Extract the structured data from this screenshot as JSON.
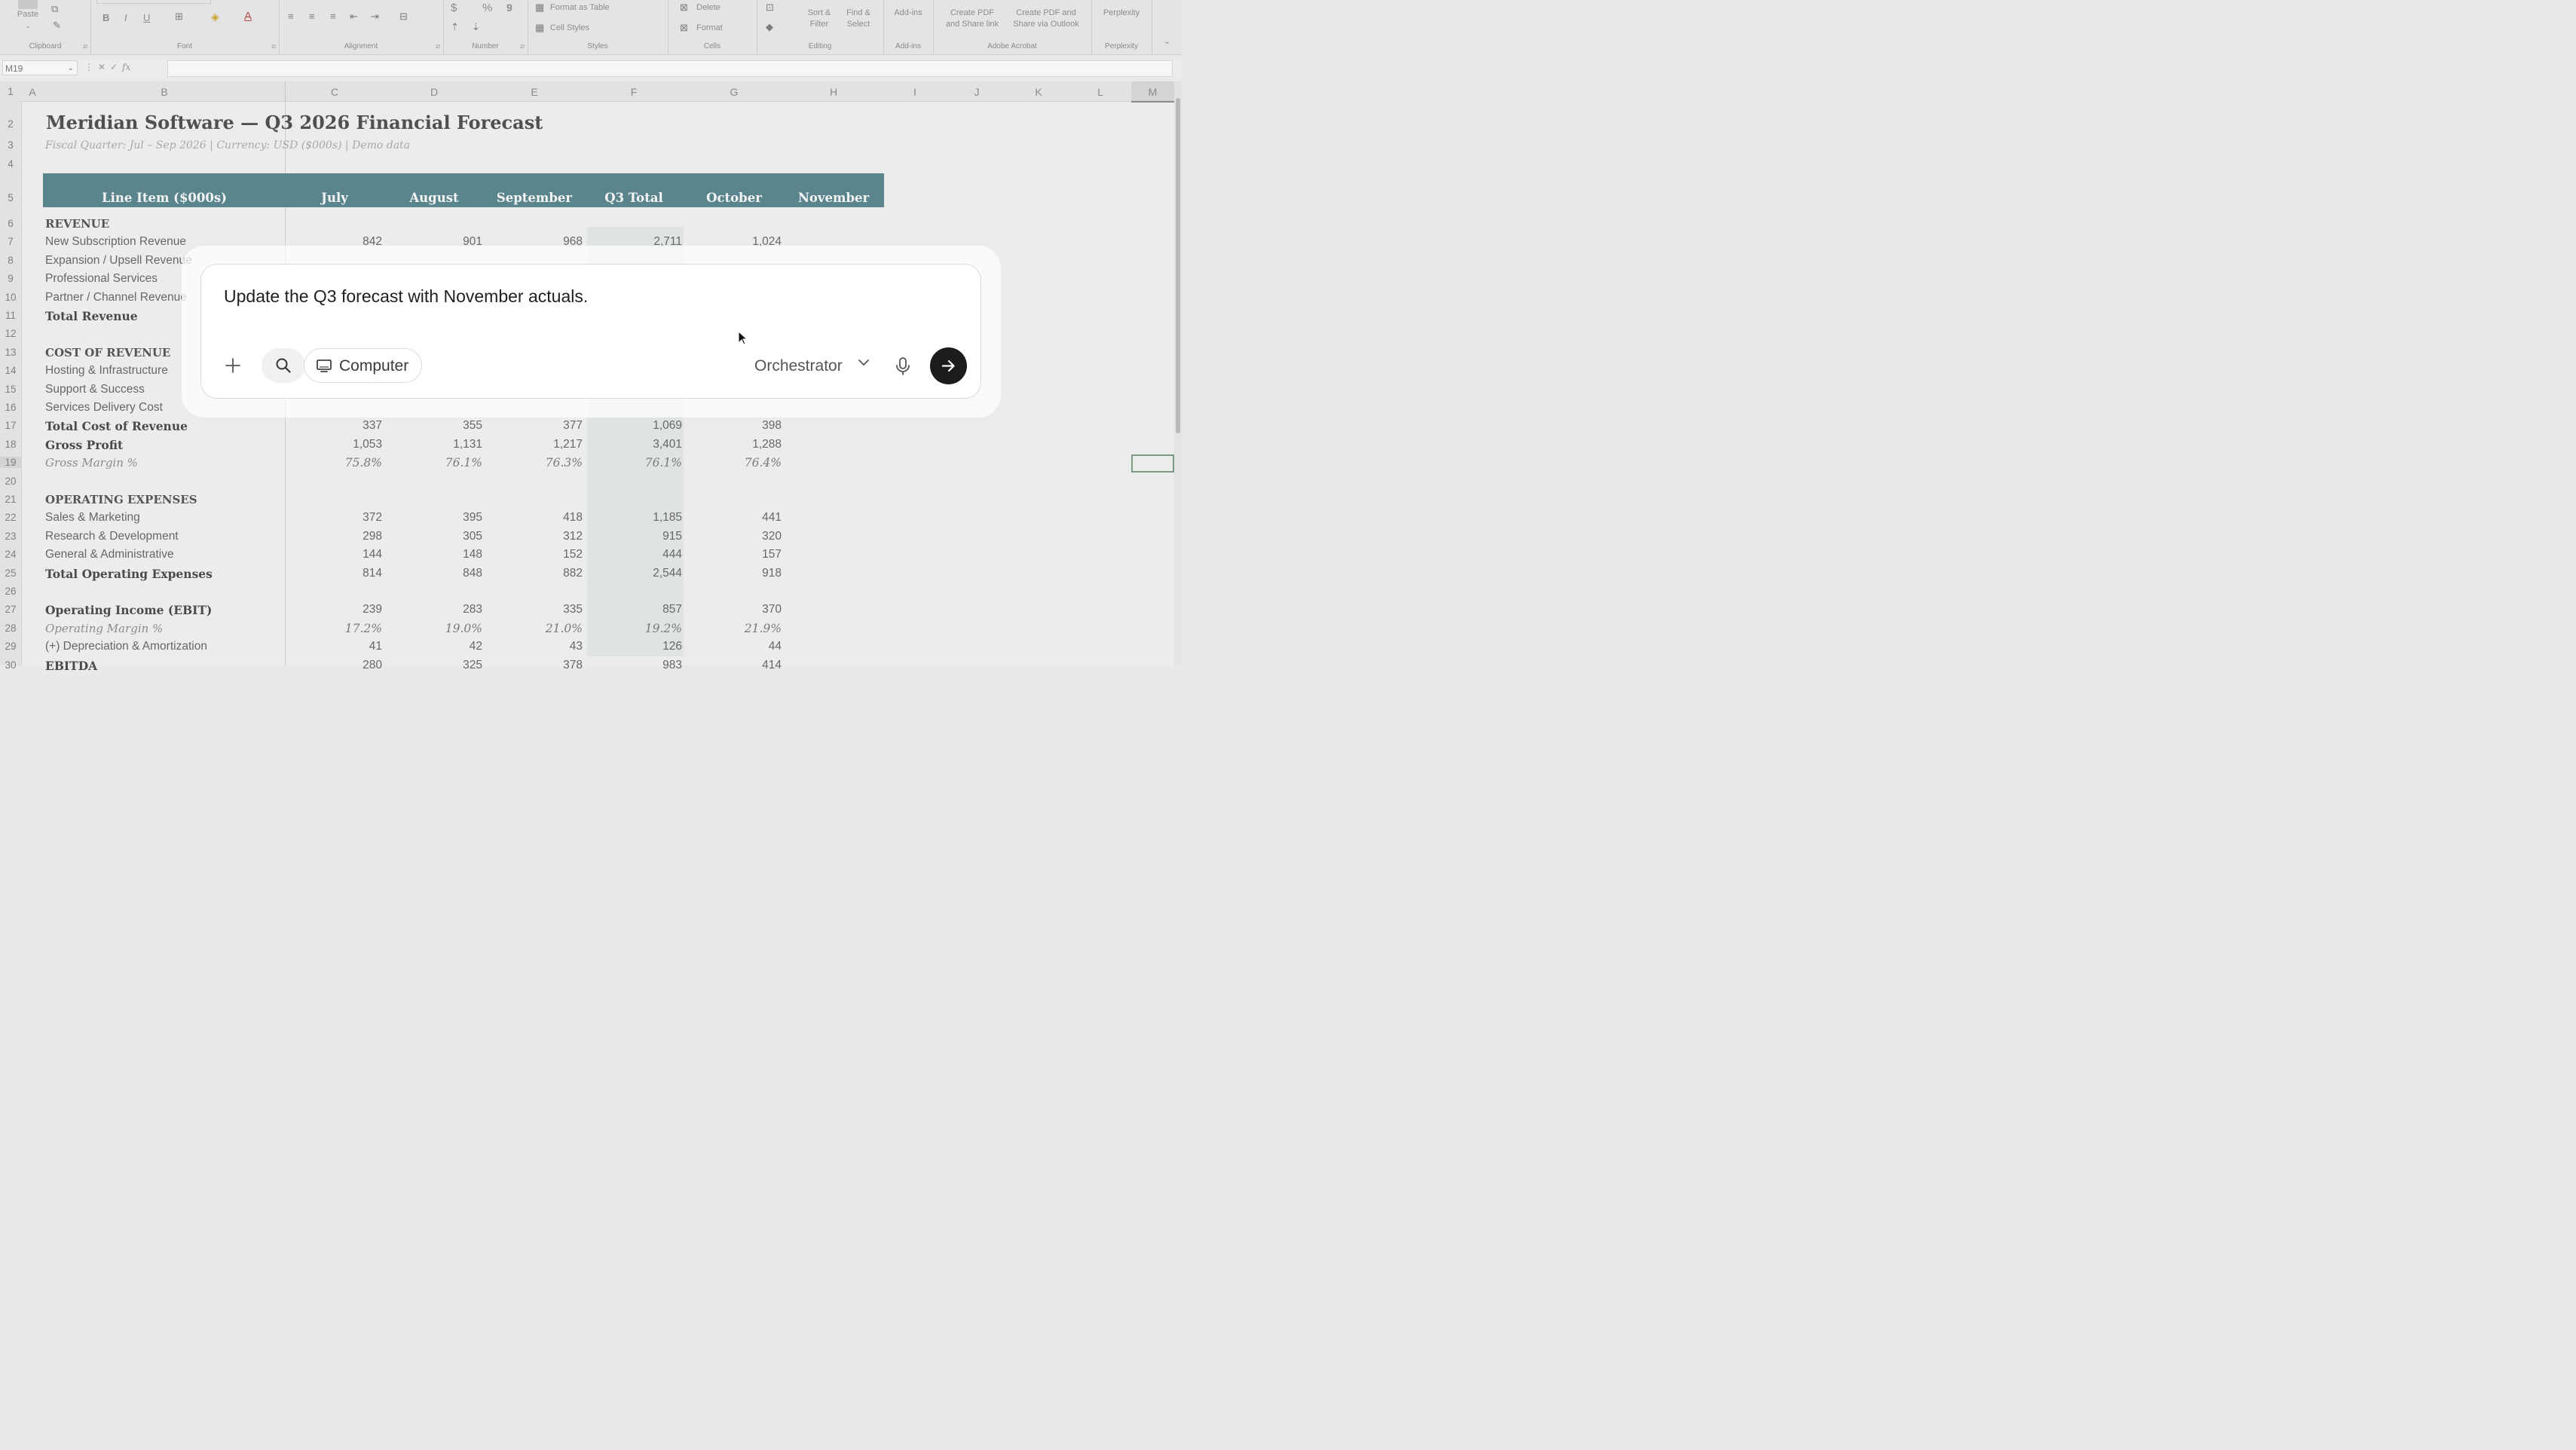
{
  "ribbon": {
    "clipboard": {
      "group_label": "Clipboard",
      "paste_label": "Paste"
    },
    "font": {
      "group_label": "Font",
      "bold": "B",
      "italic": "I",
      "underline": "U",
      "font_color": "A"
    },
    "alignment": {
      "group_label": "Alignment"
    },
    "number": {
      "group_label": "Number",
      "currency": "$",
      "percent": "%",
      "comma": "9"
    },
    "styles": {
      "group_label": "Styles",
      "format_as_table": "Format as Table",
      "cell_styles": "Cell Styles"
    },
    "cells": {
      "group_label": "Cells",
      "delete": "Delete",
      "format": "Format"
    },
    "editing": {
      "group_label": "Editing",
      "sort_filter_1": "Sort &",
      "sort_filter_2": "Filter",
      "find_select_1": "Find &",
      "find_select_2": "Select"
    },
    "addins": {
      "group_label": "Add-ins",
      "button": "Add-ins"
    },
    "acrobat": {
      "group_label": "Adobe Acrobat",
      "create_share_1": "Create PDF",
      "create_share_2": "and Share link",
      "create_outlook_1": "Create PDF and",
      "create_outlook_2": "Share via Outlook"
    },
    "perplexity": {
      "group_label": "Perplexity",
      "button": "Perplexity"
    }
  },
  "formula_bar": {
    "name_box": "M19",
    "fx": "fx",
    "value": ""
  },
  "columns": [
    "A",
    "B",
    "C",
    "D",
    "E",
    "F",
    "G",
    "H",
    "I",
    "J",
    "K",
    "L",
    "M"
  ],
  "rows": [
    "1",
    "2",
    "3",
    "4",
    "5",
    "6",
    "7",
    "8",
    "9",
    "10",
    "11",
    "12",
    "13",
    "14",
    "15",
    "16",
    "17",
    "18",
    "19",
    "20",
    "21",
    "22",
    "23",
    "24",
    "25",
    "26",
    "27",
    "28",
    "29",
    "30"
  ],
  "sheet": {
    "title": "Meridian Software — Q3 2026 Financial Forecast",
    "subtitle": "Fiscal Quarter: Jul – Sep 2026  |  Currency: USD ($000s)  |  Demo data",
    "headers": [
      "Line Item ($000s)",
      "July",
      "August",
      "September",
      "Q3 Total",
      "October",
      "November"
    ],
    "revenue_section": "REVENUE",
    "revenue_rows": [
      {
        "label": "New Subscription Revenue",
        "values": [
          "842",
          "901",
          "968",
          "2,711",
          "1,024"
        ]
      },
      {
        "label": "Expansion / Upsell Revenue",
        "values": []
      },
      {
        "label": "Professional Services",
        "values": []
      },
      {
        "label": "Partner / Channel Revenue",
        "values": []
      }
    ],
    "total_revenue": "Total Revenue",
    "cor_section": "COST OF REVENUE",
    "cor_rows": [
      {
        "label": "Hosting & Infrastructure"
      },
      {
        "label": "Support & Success"
      },
      {
        "label": "Services Delivery Cost"
      }
    ],
    "total_cor": {
      "label": "Total Cost of Revenue",
      "values": [
        "337",
        "355",
        "377",
        "1,069",
        "398"
      ]
    },
    "gross_profit": {
      "label": "Gross Profit",
      "values": [
        "1,053",
        "1,131",
        "1,217",
        "3,401",
        "1,288"
      ]
    },
    "gross_margin": {
      "label": "Gross Margin %",
      "values": [
        "75.8%",
        "76.1%",
        "76.3%",
        "76.1%",
        "76.4%"
      ]
    },
    "opex_section": "OPERATING EXPENSES",
    "opex_rows": [
      {
        "label": "Sales & Marketing",
        "values": [
          "372",
          "395",
          "418",
          "1,185",
          "441"
        ]
      },
      {
        "label": "Research & Development",
        "values": [
          "298",
          "305",
          "312",
          "915",
          "320"
        ]
      },
      {
        "label": "General & Administrative",
        "values": [
          "144",
          "148",
          "152",
          "444",
          "157"
        ]
      }
    ],
    "total_opex": {
      "label": "Total Operating Expenses",
      "values": [
        "814",
        "848",
        "882",
        "2,544",
        "918"
      ]
    },
    "ebit": {
      "label": "Operating Income (EBIT)",
      "values": [
        "239",
        "283",
        "335",
        "857",
        "370"
      ]
    },
    "op_margin": {
      "label": "Operating Margin %",
      "values": [
        "17.2%",
        "19.0%",
        "21.0%",
        "19.2%",
        "21.9%"
      ]
    },
    "da": {
      "label": "(+) Depreciation & Amortization",
      "values": [
        "41",
        "42",
        "43",
        "126",
        "44"
      ]
    },
    "ebitda": {
      "label": "EBITDA",
      "values": [
        "280",
        "325",
        "378",
        "983",
        "414"
      ]
    }
  },
  "dialog": {
    "prompt": "Update the Q3 forecast with November actuals.",
    "plus_icon": "plus-icon",
    "search_icon": "search-icon",
    "computer_label": "Computer",
    "mode_label": "Orchestrator",
    "mic_icon": "microphone-icon",
    "send_icon": "arrow-right-icon"
  },
  "colors": {
    "header_band": "#5b858d",
    "q3_highlight": "#dfe3e1",
    "send_button": "#1b1d1d"
  }
}
